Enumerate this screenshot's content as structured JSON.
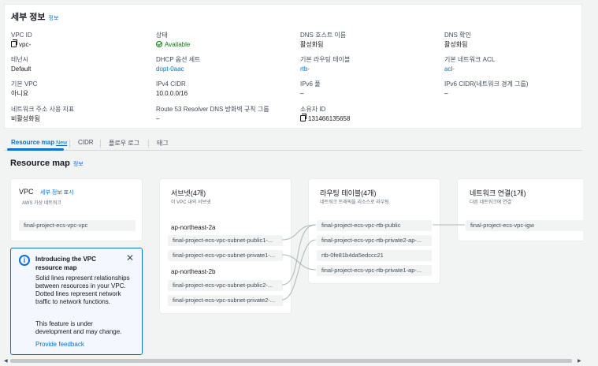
{
  "details": {
    "title": "세부 정보",
    "info_label": "정보",
    "fields": [
      {
        "label": "VPC ID",
        "value": "vpc-"
      },
      {
        "label": "상태",
        "value": "Available"
      },
      {
        "label": "DNS 호스트 이름",
        "value": "활성화됨"
      },
      {
        "label": "DNS 확인",
        "value": "활성화됨"
      },
      {
        "label": "테넌시",
        "value": "Default"
      },
      {
        "label": "DHCP 옵션 세트",
        "value": "dopt-0aac"
      },
      {
        "label": "기본 라우팅 테이블",
        "value": "rtb-"
      },
      {
        "label": "기본 네트워크 ACL",
        "value": "acl-"
      },
      {
        "label": "기본 VPC",
        "value": "아니요"
      },
      {
        "label": "IPv4 CIDR",
        "value": "10.0.0.0/16"
      },
      {
        "label": "IPv6 풀",
        "value": "–"
      },
      {
        "label": "IPv6 CIDR(네트워크 경계 그룹)",
        "value": "–"
      },
      {
        "label": "네트워크 주소 사용 지표",
        "value": "비활성화됨"
      },
      {
        "label": "Route 53 Resolver DNS 방화벽 규칙 그룹",
        "value": "–"
      },
      {
        "label": "소유자 ID",
        "value": "131466135658"
      }
    ]
  },
  "tabs": [
    {
      "label": "Resource map",
      "badge": "New"
    },
    {
      "label": "CIDR"
    },
    {
      "label": "플로우 로그"
    },
    {
      "label": "태그"
    }
  ],
  "resource_map": {
    "title": "Resource map",
    "info_label": "정보",
    "vpc_card": {
      "title": "VPC",
      "action": "세부 정보 표시",
      "subtitle": "AWS 가상 네트워크",
      "item": "final-project-ecs-vpc-vpc"
    },
    "subnets_card": {
      "title": "서브넷(4개)",
      "subtitle": "이 VPC 내의 서브넷",
      "az1": "ap-northeast-2a",
      "az1_items": [
        "final-project-ecs-vpc-subnet-public1-...",
        "final-project-ecs-vpc-subnet-private1-..."
      ],
      "az2": "ap-northeast-2b",
      "az2_items": [
        "final-project-ecs-vpc-subnet-public2-...",
        "final-project-ecs-vpc-subnet-private2-..."
      ]
    },
    "route_card": {
      "title": "라우팅 테이블(4개)",
      "subtitle": "네트워크 트래픽을 리소스로 라우팅",
      "items": [
        "final-project-ecs-vpc-rtb-public",
        "final-project-ecs-vpc-rtb-private2-ap-...",
        "rtb-0fe81b4da5edccc21",
        "final-project-ecs-vpc-rtb-private1-ap-..."
      ]
    },
    "network_card": {
      "title": "네트워크 연결(1개)",
      "subtitle": "다른 네트워크에 연결",
      "item": "final-project-ecs-vpc-igw"
    },
    "intro": {
      "title": "Introducing the VPC resource map",
      "body": "Solid lines represent relationships between resources in your VPC. Dotted lines represent network traffic to network functions.",
      "body2": "This feature is under development and may change.",
      "link": "Provide feedback"
    }
  }
}
